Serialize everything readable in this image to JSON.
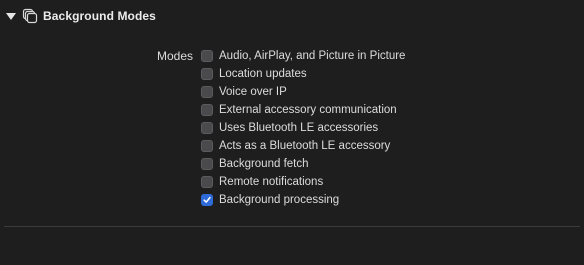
{
  "section": {
    "title": "Background Modes",
    "expanded": true,
    "icon": "layered-squares-icon"
  },
  "modes_label": "Modes",
  "options": [
    {
      "label": "Audio, AirPlay, and Picture in Picture",
      "checked": false
    },
    {
      "label": "Location updates",
      "checked": false
    },
    {
      "label": "Voice over IP",
      "checked": false
    },
    {
      "label": "External accessory communication",
      "checked": false
    },
    {
      "label": "Uses Bluetooth LE accessories",
      "checked": false
    },
    {
      "label": "Acts as a Bluetooth LE accessory",
      "checked": false
    },
    {
      "label": "Background fetch",
      "checked": false
    },
    {
      "label": "Remote notifications",
      "checked": false
    },
    {
      "label": "Background processing",
      "checked": true
    }
  ],
  "colors": {
    "background": "#1e1e1e",
    "checkbox_checked": "#2f6bd8",
    "checkbox_unchecked": "#4a4a4c",
    "divider": "#3a3a3c"
  }
}
